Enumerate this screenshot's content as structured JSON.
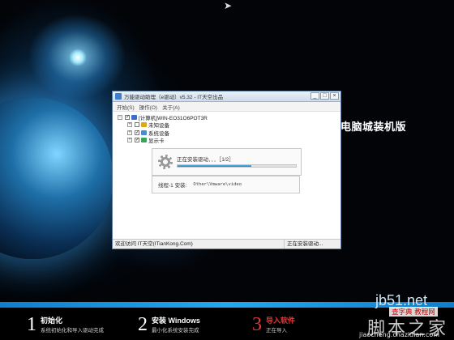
{
  "window": {
    "title": "万能驱动助理（e驱动）v5.32 - IT天空出品",
    "buttons": {
      "minimize": "_",
      "maximize": "□",
      "close": "×"
    }
  },
  "menu": [
    "开始(S)",
    "操作(O)",
    "关于(A)"
  ],
  "tree": {
    "root": "[计算机]WIN-EO31O6POT3R",
    "children": [
      {
        "label": "未知设备",
        "checked": false
      },
      {
        "label": "系统设备",
        "checked": true
      },
      {
        "label": "显示卡",
        "checked": true
      }
    ]
  },
  "progress": {
    "text": "正在安装驱动．．．［1/2］",
    "value": 0.62
  },
  "thread": {
    "label": "线程-1 安装:",
    "path": "Other\\Vmware\\video"
  },
  "status": {
    "left": "欢迎访问 IT天空(ITianKong.Com)",
    "right": "正在安装驱动..."
  },
  "brand": "电脑城装机版",
  "steps": [
    {
      "num": "1",
      "title": "初始化",
      "desc": "系统初始化和导入驱动完成",
      "active": false
    },
    {
      "num": "2",
      "title": "安装 Windows",
      "desc": "最小化系统安装完成",
      "active": false
    },
    {
      "num": "3",
      "title": "导入软件",
      "desc": "正在导入",
      "active": true
    }
  ],
  "watermark": {
    "url": "jb51.net",
    "cn": "脚本之家",
    "badge": "查字典 教程网",
    "small": "jiaocheng.chazidian.com"
  },
  "colors": {
    "accent": "#1d7fcc",
    "active_step": "#e03a3a"
  }
}
